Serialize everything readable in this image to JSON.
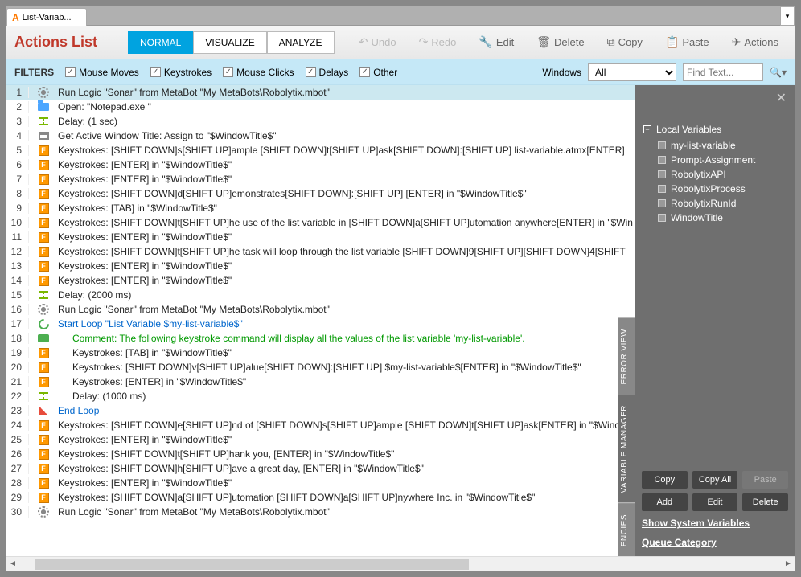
{
  "tab": {
    "title": "List-Variab..."
  },
  "toolbar": {
    "title": "Actions List",
    "modes": {
      "normal": "NORMAL",
      "visualize": "VISUALIZE",
      "analyze": "ANALYZE"
    },
    "undo": "Undo",
    "redo": "Redo",
    "edit": "Edit",
    "delete": "Delete",
    "copy": "Copy",
    "paste": "Paste",
    "actions": "Actions"
  },
  "filters": {
    "label": "FILTERS",
    "mouse_moves": "Mouse Moves",
    "keystrokes": "Keystrokes",
    "mouse_clicks": "Mouse Clicks",
    "delays": "Delays",
    "other": "Other",
    "windows_label": "Windows",
    "windows_value": "All",
    "find_placeholder": "Find Text..."
  },
  "lines": [
    {
      "n": 1,
      "icon": "gear",
      "text": "Run Logic \"Sonar\" from MetaBot \"My MetaBots\\Robolytix.mbot\"",
      "sel": true
    },
    {
      "n": 2,
      "icon": "folder",
      "text": "Open: \"Notepad.exe \""
    },
    {
      "n": 3,
      "icon": "delay",
      "text": "Delay: (1 sec)"
    },
    {
      "n": 4,
      "icon": "window",
      "text": "Get Active Window Title: Assign to \"$WindowTitle$\""
    },
    {
      "n": 5,
      "icon": "key",
      "text": "Keystrokes: [SHIFT DOWN]s[SHIFT UP]ample [SHIFT DOWN]t[SHIFT UP]ask[SHIFT DOWN]:[SHIFT UP]  list-variable.atmx[ENTER]"
    },
    {
      "n": 6,
      "icon": "key",
      "text": "Keystrokes: [ENTER] in \"$WindowTitle$\""
    },
    {
      "n": 7,
      "icon": "key",
      "text": "Keystrokes: [ENTER] in \"$WindowTitle$\""
    },
    {
      "n": 8,
      "icon": "key",
      "text": "Keystrokes: [SHIFT DOWN]d[SHIFT UP]emonstrates[SHIFT DOWN]:[SHIFT UP]       [ENTER] in \"$WindowTitle$\""
    },
    {
      "n": 9,
      "icon": "key",
      "text": "Keystrokes: [TAB] in \"$WindowTitle$\""
    },
    {
      "n": 10,
      "icon": "key",
      "text": "Keystrokes: [SHIFT DOWN]t[SHIFT UP]he use of the list variable in [SHIFT DOWN]a[SHIFT UP]utomation anywhere[ENTER] in \"$Win"
    },
    {
      "n": 11,
      "icon": "key",
      "text": "Keystrokes: [ENTER] in \"$WindowTitle$\""
    },
    {
      "n": 12,
      "icon": "key",
      "text": "Keystrokes: [SHIFT DOWN]t[SHIFT UP]he task will loop through the list variable [SHIFT DOWN]9[SHIFT UP][SHIFT DOWN]4[SHIFT"
    },
    {
      "n": 13,
      "icon": "key",
      "text": "Keystrokes: [ENTER] in \"$WindowTitle$\""
    },
    {
      "n": 14,
      "icon": "key",
      "text": "Keystrokes: [ENTER] in \"$WindowTitle$\""
    },
    {
      "n": 15,
      "icon": "delay",
      "text": "Delay: (2000 ms)"
    },
    {
      "n": 16,
      "icon": "gear",
      "text": "Run Logic \"Sonar\" from MetaBot \"My MetaBots\\Robolytix.mbot\""
    },
    {
      "n": 17,
      "icon": "loop",
      "text": "Start Loop \"List Variable $my-list-variable$\"",
      "color": "blue"
    },
    {
      "n": 18,
      "icon": "comment",
      "text": "Comment: The following keystroke command will display all the values of the list variable 'my-list-variable'.",
      "color": "green",
      "indent": 1
    },
    {
      "n": 19,
      "icon": "key",
      "text": "Keystrokes: [TAB] in \"$WindowTitle$\"",
      "indent": 1
    },
    {
      "n": 20,
      "icon": "key",
      "text": "Keystrokes: [SHIFT DOWN]v[SHIFT UP]alue[SHIFT DOWN]:[SHIFT UP] $my-list-variable$[ENTER] in \"$WindowTitle$\"",
      "indent": 1
    },
    {
      "n": 21,
      "icon": "key",
      "text": "Keystrokes: [ENTER] in \"$WindowTitle$\"",
      "indent": 1
    },
    {
      "n": 22,
      "icon": "delay",
      "text": "Delay: (1000 ms)",
      "indent": 1
    },
    {
      "n": 23,
      "icon": "loopend",
      "text": "End Loop",
      "color": "blue"
    },
    {
      "n": 24,
      "icon": "key",
      "text": "Keystrokes: [SHIFT DOWN]e[SHIFT UP]nd of [SHIFT DOWN]s[SHIFT UP]ample [SHIFT DOWN]t[SHIFT UP]ask[ENTER] in \"$Windo"
    },
    {
      "n": 25,
      "icon": "key",
      "text": "Keystrokes: [ENTER] in \"$WindowTitle$\""
    },
    {
      "n": 26,
      "icon": "key",
      "text": "Keystrokes: [SHIFT DOWN]t[SHIFT UP]hank you, [ENTER] in \"$WindowTitle$\""
    },
    {
      "n": 27,
      "icon": "key",
      "text": "Keystrokes: [SHIFT DOWN]h[SHIFT UP]ave a great day, [ENTER] in \"$WindowTitle$\""
    },
    {
      "n": 28,
      "icon": "key",
      "text": "Keystrokes: [ENTER] in \"$WindowTitle$\""
    },
    {
      "n": 29,
      "icon": "key",
      "text": "Keystrokes: [SHIFT DOWN]a[SHIFT UP]utomation [SHIFT DOWN]a[SHIFT UP]nywhere Inc. in \"$WindowTitle$\""
    },
    {
      "n": 30,
      "icon": "gear",
      "text": "Run Logic \"Sonar\" from MetaBot \"My MetaBots\\Robolytix.mbot\""
    }
  ],
  "side": {
    "root": "Local Variables",
    "vars": [
      "my-list-variable",
      "Prompt-Assignment",
      "RobolytixAPI",
      "RobolytixProcess",
      "RobolytixRunId",
      "WindowTitle"
    ],
    "copy": "Copy",
    "copy_all": "Copy All",
    "paste": "Paste",
    "add": "Add",
    "edit": "Edit",
    "delete": "Delete",
    "link1": "Show System Variables",
    "link2": "Queue Category"
  },
  "side_tabs": {
    "error": "ERROR VIEW",
    "varmgr": "VARIABLE MANAGER",
    "deps": "ENCIES"
  }
}
